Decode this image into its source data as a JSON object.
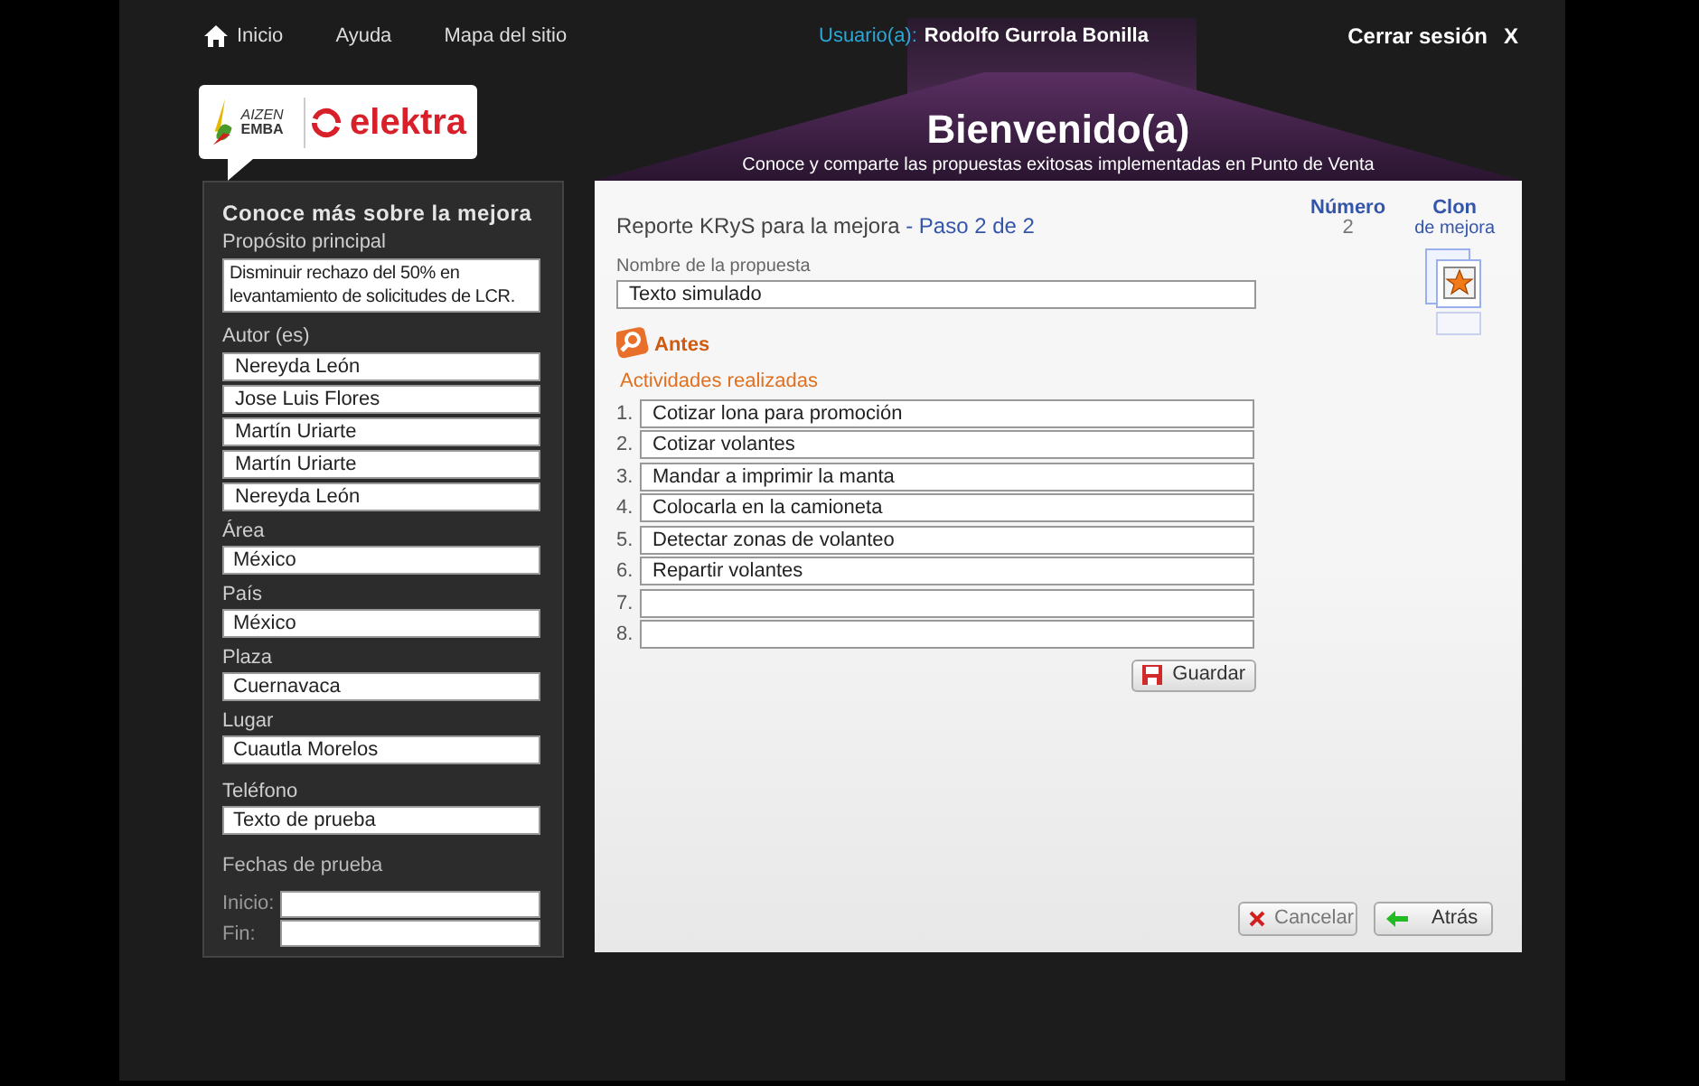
{
  "nav": {
    "links": [
      {
        "label": "Inicio",
        "kind": "home"
      },
      {
        "label": "Ayuda",
        "kind": "plain"
      },
      {
        "label": "Mapa del sitio",
        "kind": "plain"
      }
    ],
    "user_label": "Usuario(a):",
    "user_name": "Rodolfo Gurrola Bonilla",
    "logout": "Cerrar sesión",
    "logout_x": "X"
  },
  "logo": {
    "kaizen_top": "AIZEN",
    "kaizen_bottom": "EMBA",
    "brand": "elektra"
  },
  "header": {
    "title": "Bienvenido(a)",
    "subtitle": "Conoce y comparte las propuestas exitosas implementadas en Punto de Venta"
  },
  "sidebar": {
    "title": "Conoce más sobre la mejora",
    "purpose": {
      "label": "Propósito principal",
      "value": "Disminuir rechazo del 50% en levantamiento de solicitudes de LCR."
    },
    "authors": {
      "label": "Autor (es)",
      "values": [
        "Nereyda León",
        "Jose Luis Flores",
        "Martín Uriarte",
        "Martín Uriarte",
        "Nereyda León"
      ]
    },
    "fields": [
      {
        "label": "Área",
        "value": "México"
      },
      {
        "label": "País",
        "value": "México"
      },
      {
        "label": "Plaza",
        "value": "Cuernavaca"
      },
      {
        "label": "Lugar",
        "value": "Cuautla Morelos"
      },
      {
        "label": "Teléfono",
        "value": "Texto de prueba"
      }
    ],
    "dates": {
      "label": "Fechas de prueba",
      "fields": [
        {
          "label": "Inicio:"
        },
        {
          "label": "Fin:"
        }
      ]
    }
  },
  "main": {
    "title": "Reporte KRyS para la mejora",
    "step": "- Paso 2 de 2",
    "number": {
      "label": "Número",
      "value": "2"
    },
    "clone": {
      "label": "Clon",
      "sublabel": "de mejora"
    },
    "name_field": {
      "label": "Nombre de la propuesta",
      "value": "Texto simulado"
    },
    "section": "Antes",
    "activities": {
      "label": "Actividades realizadas",
      "items": [
        {
          "number": "1.",
          "value": "Cotizar lona para promoción"
        },
        {
          "number": "2.",
          "value": "Cotizar volantes"
        },
        {
          "number": "3.",
          "value": "Mandar a imprimir la manta"
        },
        {
          "number": "4.",
          "value": "Colocarla en la camioneta"
        },
        {
          "number": "5.",
          "value": "Detectar zonas de volanteo"
        },
        {
          "number": "6.",
          "value": "Repartir volantes"
        },
        {
          "number": "7."
        },
        {
          "number": "8."
        }
      ]
    },
    "save_button": "Guardar",
    "buttons": [
      {
        "kind": "cancel",
        "label": "Cancelar"
      },
      {
        "kind": "back",
        "label": "Atrás"
      }
    ]
  }
}
